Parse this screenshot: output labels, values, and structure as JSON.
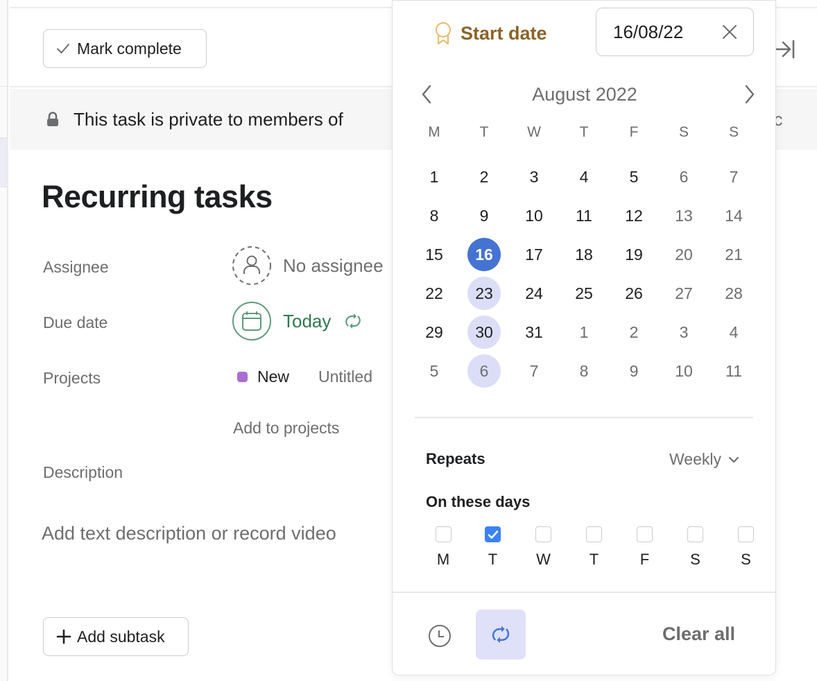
{
  "toolbar": {
    "mark_complete_label": "Mark complete"
  },
  "privacy_banner": {
    "text": "This task is private to members of",
    "truncated_tail": "lic"
  },
  "task": {
    "title": "Recurring tasks",
    "fields": {
      "assignee_label": "Assignee",
      "assignee_value": "No assignee",
      "due_date_label": "Due date",
      "due_date_value": "Today",
      "projects_label": "Projects",
      "projects": [
        {
          "name": "New",
          "color": "#a86fcf"
        },
        {
          "name": "Untitled"
        }
      ],
      "add_to_projects": "Add to projects",
      "description_label": "Description",
      "description_placeholder": "Add text description or record video"
    },
    "add_subtask_label": "Add subtask"
  },
  "date_picker": {
    "start_date_label": "Start date",
    "date_input_value": "16/08/22",
    "month_label": "August 2022",
    "weekday_headers": [
      "M",
      "T",
      "W",
      "T",
      "F",
      "S",
      "S"
    ],
    "weeks": [
      [
        {
          "d": "1"
        },
        {
          "d": "2"
        },
        {
          "d": "3"
        },
        {
          "d": "4"
        },
        {
          "d": "5"
        },
        {
          "d": "6",
          "muted": true
        },
        {
          "d": "7",
          "muted": true
        }
      ],
      [
        {
          "d": "8"
        },
        {
          "d": "9"
        },
        {
          "d": "10"
        },
        {
          "d": "11"
        },
        {
          "d": "12"
        },
        {
          "d": "13",
          "muted": true
        },
        {
          "d": "14",
          "muted": true
        }
      ],
      [
        {
          "d": "15"
        },
        {
          "d": "16",
          "selected": true
        },
        {
          "d": "17"
        },
        {
          "d": "18"
        },
        {
          "d": "19"
        },
        {
          "d": "20",
          "muted": true
        },
        {
          "d": "21",
          "muted": true
        }
      ],
      [
        {
          "d": "22"
        },
        {
          "d": "23",
          "recurring": true
        },
        {
          "d": "24"
        },
        {
          "d": "25"
        },
        {
          "d": "26"
        },
        {
          "d": "27",
          "muted": true
        },
        {
          "d": "28",
          "muted": true
        }
      ],
      [
        {
          "d": "29"
        },
        {
          "d": "30",
          "recurring": true
        },
        {
          "d": "31"
        },
        {
          "d": "1",
          "muted": true
        },
        {
          "d": "2",
          "muted": true
        },
        {
          "d": "3",
          "muted": true
        },
        {
          "d": "4",
          "muted": true
        }
      ],
      [
        {
          "d": "5",
          "muted": true
        },
        {
          "d": "6",
          "muted": true,
          "recurring": true
        },
        {
          "d": "7",
          "muted": true
        },
        {
          "d": "8",
          "muted": true
        },
        {
          "d": "9",
          "muted": true
        },
        {
          "d": "10",
          "muted": true
        },
        {
          "d": "11",
          "muted": true
        }
      ]
    ],
    "repeats_label": "Repeats",
    "repeats_value": "Weekly",
    "on_these_days_label": "On these days",
    "days": [
      {
        "letter": "M",
        "checked": false
      },
      {
        "letter": "T",
        "checked": true
      },
      {
        "letter": "W",
        "checked": false
      },
      {
        "letter": "T",
        "checked": false
      },
      {
        "letter": "F",
        "checked": false
      },
      {
        "letter": "S",
        "checked": false
      },
      {
        "letter": "S",
        "checked": false
      }
    ],
    "clear_all_label": "Clear all"
  },
  "colors": {
    "selected_day": "#4573d2",
    "recurring_day": "#dcdef8",
    "due_date_green": "#2e7a50",
    "start_date_gold": "#8c6328",
    "checkbox_checked": "#3b82f6"
  }
}
